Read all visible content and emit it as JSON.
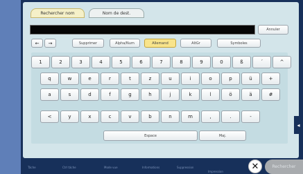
{
  "tabs": [
    {
      "label": "Rechercher nom"
    },
    {
      "label": "Nom de dest."
    }
  ],
  "input": {
    "value": ""
  },
  "toolbar": {
    "cancel": "Annuler",
    "left_arrow": "←",
    "right_arrow": "→",
    "delete": "Supprimer",
    "modes": [
      "Alpha/Num",
      "Allemand",
      "AltGr",
      "Symboles"
    ]
  },
  "keyboard": {
    "row1": [
      "1",
      "2",
      "3",
      "4",
      "5",
      "6",
      "7",
      "8",
      "9",
      "0",
      "ß",
      "´",
      "^"
    ],
    "row2": [
      "q",
      "w",
      "e",
      "r",
      "t",
      "z",
      "u",
      "i",
      "o",
      "p",
      "ü",
      "+"
    ],
    "row3": [
      "a",
      "s",
      "d",
      "f",
      "g",
      "h",
      "j",
      "k",
      "l",
      "ö",
      "ä",
      "#"
    ],
    "row4": [
      "<",
      "y",
      "x",
      "c",
      "v",
      "b",
      "n",
      "m",
      ",",
      ".",
      "-"
    ],
    "space": "Espace",
    "shift": "Maj."
  },
  "side_tab": "◂",
  "footer": {
    "close": "✕",
    "ok": "Rechercher",
    "status": [
      "Tâche",
      "Ctrl tâche",
      "Mode vue",
      "Informations",
      "Suppression",
      "Impression"
    ]
  }
}
